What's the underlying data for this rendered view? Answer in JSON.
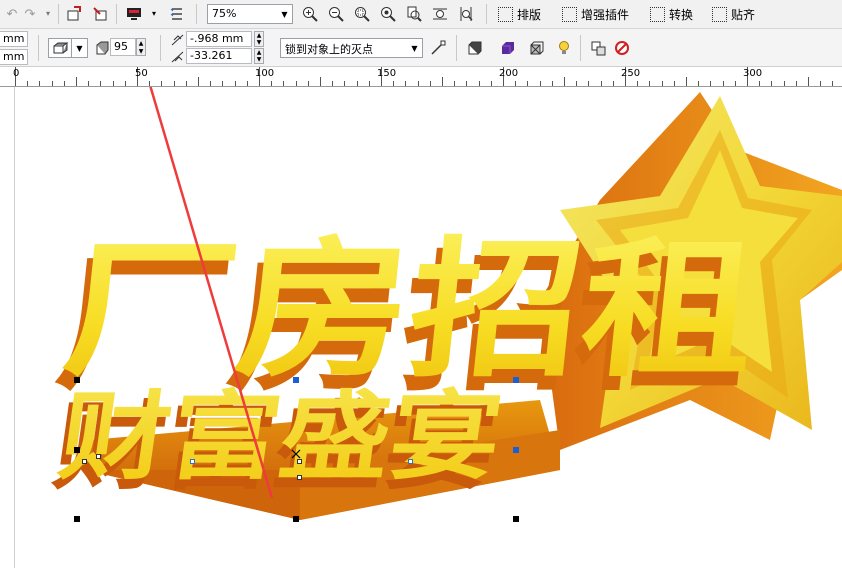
{
  "toolbar_top": {
    "zoom_value": "75%",
    "menus": [
      {
        "label": "排版",
        "icon": "layout-icon"
      },
      {
        "label": "增强插件",
        "icon": "plugin-icon"
      },
      {
        "label": "转换",
        "icon": "convert-icon"
      },
      {
        "label": "贴齐",
        "icon": "snap-icon"
      }
    ]
  },
  "property_bar": {
    "left_unit_top": "mm",
    "left_unit_bottom": "mm",
    "step_value": "95",
    "offset_x": "-.968 mm",
    "offset_y": "-33.261 mm",
    "lock_option": "锁到对象上的灭点"
  },
  "ruler": {
    "labels": [
      "0",
      "50",
      "100",
      "150",
      "200",
      "250",
      "300"
    ]
  },
  "artwork": {
    "line1": "厂房招租",
    "line2": "财富盛宴",
    "colors": {
      "face_light": "#fbf04a",
      "face_mid": "#f7d51c",
      "extrude_dark": "#c9540a",
      "extrude_mid": "#e68a12",
      "star_light": "#f4e24a",
      "annotation_arrow": "#ef3b3b"
    }
  }
}
